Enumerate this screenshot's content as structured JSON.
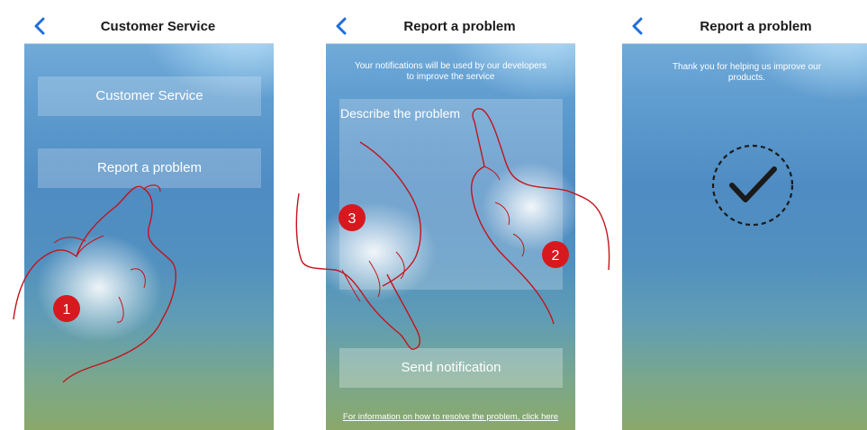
{
  "screen1": {
    "title": "Customer Service",
    "buttons": [
      "Customer Service",
      "Report a problem"
    ]
  },
  "screen2": {
    "title": "Report a problem",
    "info": "Your notifications will be used by our developers to improve the service",
    "placeholder": "Describe the problem",
    "send_label": "Send notification",
    "help_link": "For information on how to resolve the problem, click here"
  },
  "screen3": {
    "title": "Report a problem",
    "message": "Thank you for helping us improve our products."
  },
  "steps": [
    "1",
    "2",
    "3"
  ],
  "colors": {
    "accent": "#1e6fd9",
    "step_badge": "#d7191f",
    "hand_outline": "#c3141b"
  },
  "icons": {
    "back": "chevron-left-icon",
    "success": "checkmark-circle-icon"
  }
}
